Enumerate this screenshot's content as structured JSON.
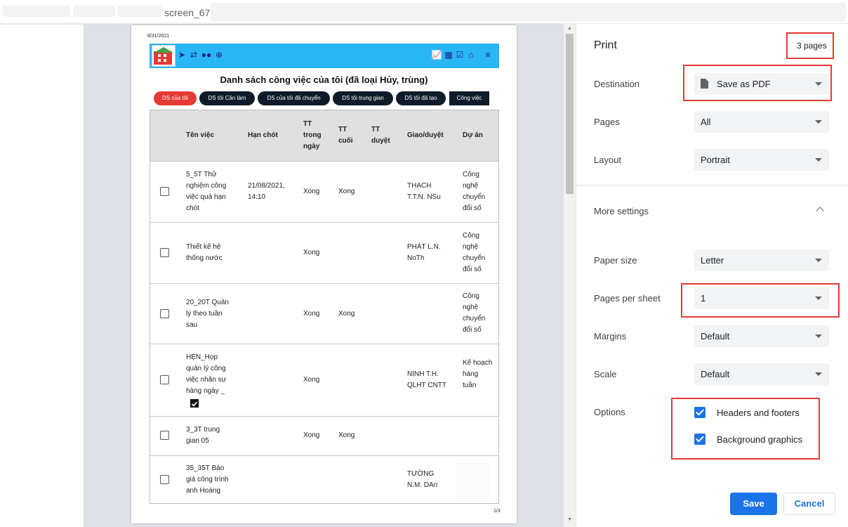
{
  "window": {
    "title": "screen_67"
  },
  "preview": {
    "date": "8/31/2021",
    "page_number": "1/3",
    "doc_title": "Danh sách công việc của tôi (đã loại Hủy, trùng)",
    "tabs": [
      "DS của tôi",
      "DS tôi Cần làm",
      "DS của tôi đã chuyển",
      "DS tôi trung gian",
      "DS tôi đã tạo",
      "Công việc"
    ],
    "headers": [
      "Tên việc",
      "Hạn chót",
      "TT trong ngày",
      "TT cuối",
      "TT duyệt",
      "Giao/duyệt",
      "Dự án"
    ],
    "rows": [
      {
        "name": "5_5T Thử nghiệm công việc quá hạn chót",
        "deadline": "21/08/2021, 14:10",
        "tt_day": "Xong",
        "tt_final": "Xong",
        "tt_approve": "",
        "assign": "THẠCH T.T.N. NSu",
        "project": "Công nghệ chuyển đổi số"
      },
      {
        "name": "Thiết kế hệ thống nước",
        "deadline": "",
        "tt_day": "Xong",
        "tt_final": "",
        "tt_approve": "",
        "assign": "PHÁT L.N. NoTh",
        "project": "Công nghệ chuyển đổi số"
      },
      {
        "name": "20_20T Quản lý theo tuần sau",
        "deadline": "",
        "tt_day": "Xong",
        "tt_final": "Xong",
        "tt_approve": "",
        "assign": "",
        "project": "Công nghệ chuyển đổi số"
      },
      {
        "name": "HẸN_Họp quản lý công việc nhân sự hàng ngày _",
        "deadline": "",
        "tt_day": "Xong",
        "tt_final": "",
        "tt_approve": "",
        "assign": "NINH T.H. QLHT CNTT",
        "project": "Kế hoạch hàng tuần"
      },
      {
        "name": "3_3T trung gian 05",
        "deadline": "",
        "tt_day": "Xong",
        "tt_final": "Xong",
        "tt_approve": "",
        "assign": "",
        "project": ""
      },
      {
        "name": "35_35T Báo giá công trình anh Hoàng",
        "deadline": "",
        "tt_day": "",
        "tt_final": "",
        "tt_approve": "",
        "assign": "TƯỜNG N.M. DAn",
        "project": ""
      }
    ]
  },
  "print": {
    "title": "Print",
    "sheet_count": "3 pages",
    "destination_label": "Destination",
    "destination_value": "Save as PDF",
    "pages_label": "Pages",
    "pages_value": "All",
    "layout_label": "Layout",
    "layout_value": "Portrait",
    "more_settings": "More settings",
    "paper_size_label": "Paper size",
    "paper_size_value": "Letter",
    "pages_per_sheet_label": "Pages per sheet",
    "pages_per_sheet_value": "1",
    "margins_label": "Margins",
    "margins_value": "Default",
    "scale_label": "Scale",
    "scale_value": "Default",
    "options_label": "Options",
    "option_headers": "Headers and footers",
    "option_background": "Background graphics",
    "save": "Save",
    "cancel": "Cancel"
  },
  "colors": {
    "accent": "#1a73e8",
    "highlight": "#e53935",
    "app_header": "#29b6f6"
  }
}
